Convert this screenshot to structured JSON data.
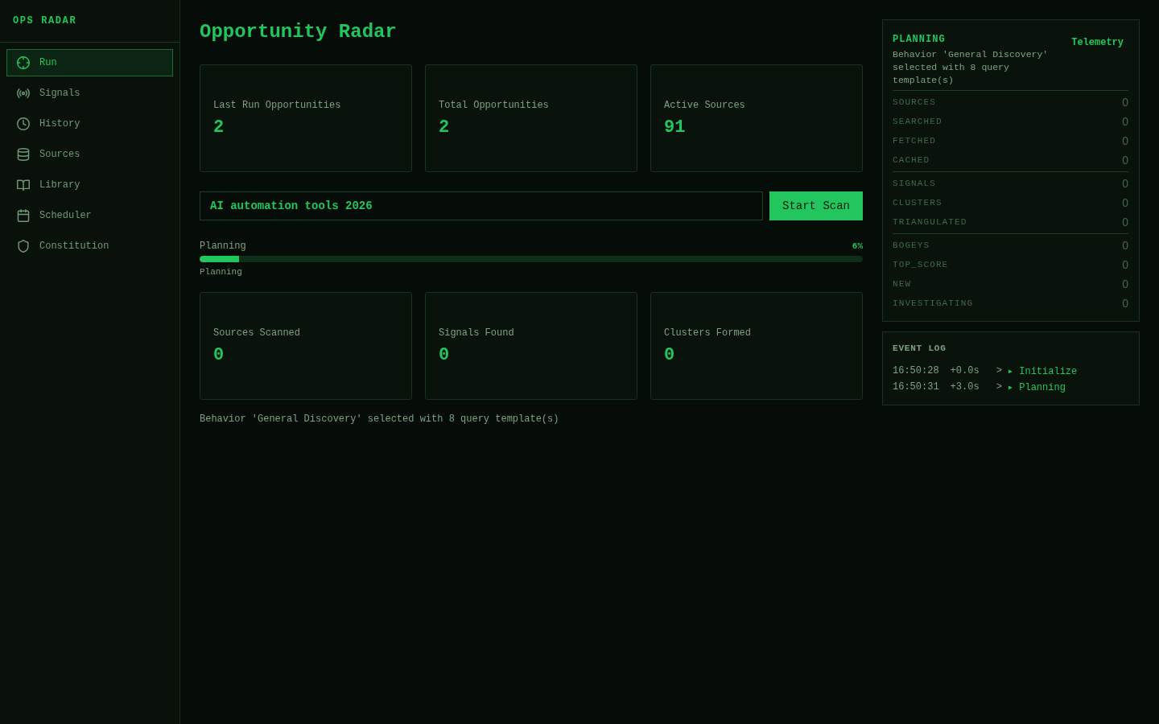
{
  "sidebar": {
    "title": "OPS RADAR",
    "items": [
      {
        "label": "Run",
        "selected": true
      },
      {
        "label": "Signals",
        "selected": false
      },
      {
        "label": "History",
        "selected": false
      },
      {
        "label": "Sources",
        "selected": false
      },
      {
        "label": "Library",
        "selected": false
      },
      {
        "label": "Scheduler",
        "selected": false
      },
      {
        "label": "Constitution",
        "selected": false
      }
    ]
  },
  "page": {
    "title": "Opportunity Radar"
  },
  "summary_cards": [
    {
      "label": "Last Run Opportunities",
      "value": "2"
    },
    {
      "label": "Total Opportunities",
      "value": "2"
    },
    {
      "label": "Active Sources",
      "value": "91"
    }
  ],
  "scan": {
    "query": "AI automation tools 2026",
    "button": "Start Scan"
  },
  "progress": {
    "label": "Planning",
    "percent": "6%",
    "level": 0.06,
    "status": "Planning"
  },
  "scan_cards": [
    {
      "label": "Sources Scanned",
      "value": "0"
    },
    {
      "label": "Signals Found",
      "value": "0"
    },
    {
      "label": "Clusters Formed",
      "value": "0"
    }
  ],
  "message": "Behavior 'General Discovery' selected with 8 query template(s)",
  "telemetry": {
    "phase": "PLANNING",
    "toggle": "Telemetry",
    "description": "Behavior 'General Discovery' selected with 8 query template(s)",
    "groups": [
      {
        "metrics": [
          {
            "label": "SOURCES",
            "value": "0"
          },
          {
            "label": "SEARCHED",
            "value": "0"
          },
          {
            "label": "FETCHED",
            "value": "0"
          },
          {
            "label": "CACHED",
            "value": "0"
          }
        ]
      },
      {
        "metrics": [
          {
            "label": "SIGNALS",
            "value": "0"
          },
          {
            "label": "CLUSTERS",
            "value": "0"
          },
          {
            "label": "TRIANGULATED",
            "value": "0"
          }
        ]
      },
      {
        "metrics": [
          {
            "label": "BOGEYS",
            "value": "0"
          },
          {
            "label": "TOP_SCORE",
            "value": "0"
          },
          {
            "label": "NEW",
            "value": "0"
          },
          {
            "label": "INVESTIGATING",
            "value": "0"
          }
        ]
      }
    ]
  },
  "event_log": {
    "title": "EVENT LOG",
    "entries": [
      {
        "time": "16:50:28",
        "offset": "+0.0s",
        "prompt": ">",
        "event": "▸ Initialize"
      },
      {
        "time": "16:50:31",
        "offset": "+3.0s",
        "prompt": ">",
        "event": "▸ Planning"
      }
    ]
  }
}
